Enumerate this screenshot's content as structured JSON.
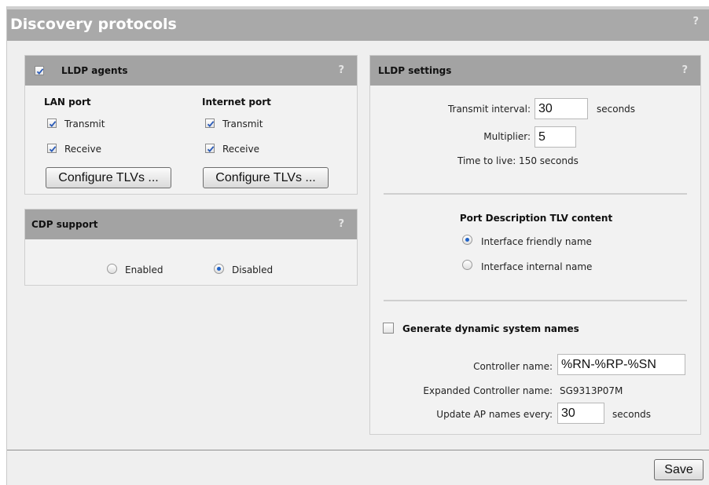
{
  "page": {
    "title": "Discovery protocols",
    "help": "?"
  },
  "lldp_agents": {
    "title": "LLDP agents",
    "enabled": true,
    "help": "?",
    "lan_heading": "LAN port",
    "internet_heading": "Internet port",
    "transmit_label": "Transmit",
    "receive_label": "Receive",
    "lan_transmit": true,
    "lan_receive": true,
    "internet_transmit": true,
    "internet_receive": true,
    "configure_label": "Configure TLVs ..."
  },
  "cdp_support": {
    "title": "CDP support",
    "help": "?",
    "enabled_label": "Enabled",
    "disabled_label": "Disabled",
    "selected": "Disabled"
  },
  "lldp_settings": {
    "title": "LLDP settings",
    "help": "?",
    "transmit_interval_label": "Transmit interval:",
    "transmit_interval_value": "30",
    "seconds": "seconds",
    "multiplier_label": "Multiplier:",
    "multiplier_value": "5",
    "ttl_text": "Time to live: 150 seconds",
    "port_desc_heading": "Port Description TLV content",
    "friendly_label": "Interface friendly name",
    "internal_label": "Interface internal name",
    "port_desc_selected": "Interface friendly name",
    "generate_label": "Generate dynamic system names",
    "generate_checked": false,
    "controller_name_label": "Controller name:",
    "controller_name_value": "%RN-%RP-%SN",
    "expanded_label": "Expanded Controller name:",
    "expanded_value": "SG9313P07M",
    "update_label": "Update AP names every:",
    "update_value": "30"
  },
  "footer": {
    "save_label": "Save"
  },
  "colors": {
    "title_bar": "#a9a9a9",
    "panel_header": "#a3a3a3",
    "check_mark": "#2a5bb8",
    "radio_dot": "#1f62c7"
  }
}
